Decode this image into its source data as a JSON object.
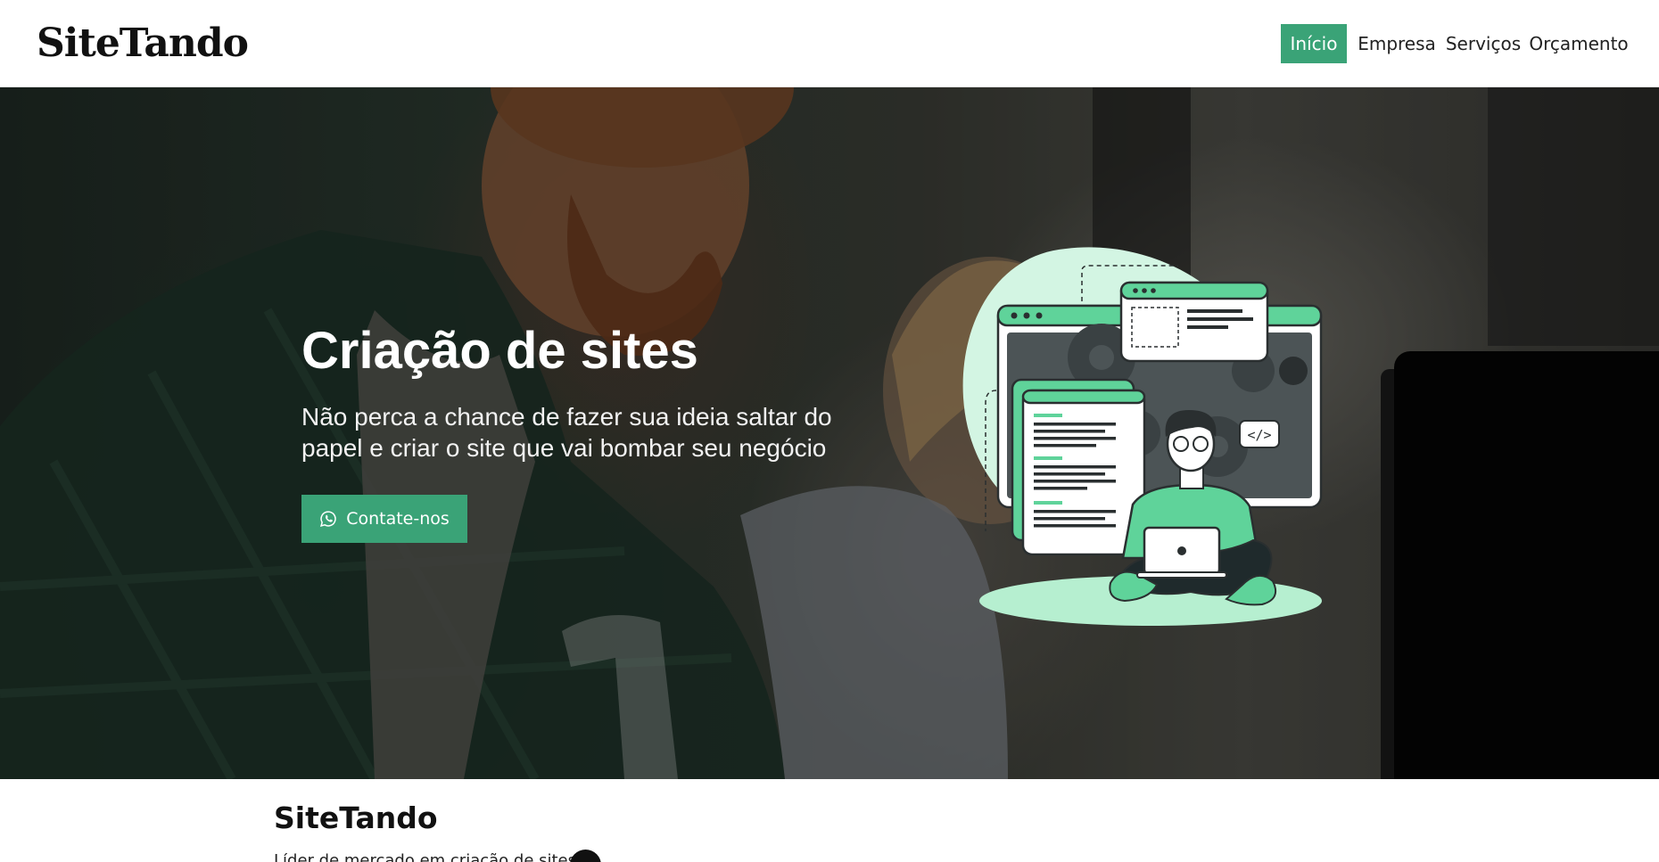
{
  "brand": {
    "name": "SiteTando"
  },
  "nav": {
    "items": [
      {
        "label": "Início",
        "active": true
      },
      {
        "label": "Empresa",
        "active": false
      },
      {
        "label": "Serviços",
        "active": false
      },
      {
        "label": "Orçamento",
        "active": false
      }
    ]
  },
  "hero": {
    "title": "Criação de sites",
    "subtitle": "Não perca a chance de fazer sua ideia saltar do papel e criar o site que vai bombar seu negócio",
    "cta_label": "Contate-nos",
    "cta_icon": "whatsapp-icon"
  },
  "section": {
    "title": "SiteTando",
    "subtitle": "Líder de mercado em criação de sites"
  },
  "colors": {
    "accent": "#3aa377",
    "accent_light": "#c6f2dc",
    "illustration_green": "#5fd39a",
    "dark": "#1f2a2c"
  }
}
